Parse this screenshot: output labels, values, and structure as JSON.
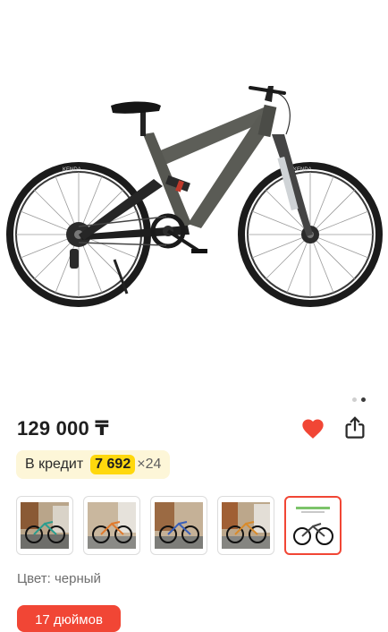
{
  "product": {
    "price": "129 000 ₸",
    "credit": {
      "label": "В кредит",
      "amount": "7 692",
      "multiplier": "×24"
    },
    "color_label": "Цвет: черный",
    "size_option": "17 дюймов",
    "tire_brand": "KENDA",
    "gallery_pages": 2,
    "active_page": 2,
    "favorite": true,
    "favorite_color": "#f14635"
  },
  "thumbnails": [
    {
      "id": "photo-1",
      "selected": false
    },
    {
      "id": "photo-2",
      "selected": false
    },
    {
      "id": "photo-3",
      "selected": false
    },
    {
      "id": "photo-4",
      "selected": false
    },
    {
      "id": "photo-5",
      "selected": true
    }
  ],
  "colors": {
    "accent": "#f14635",
    "credit_bg": "#fdf6d8",
    "credit_highlight": "#ffd80d"
  }
}
